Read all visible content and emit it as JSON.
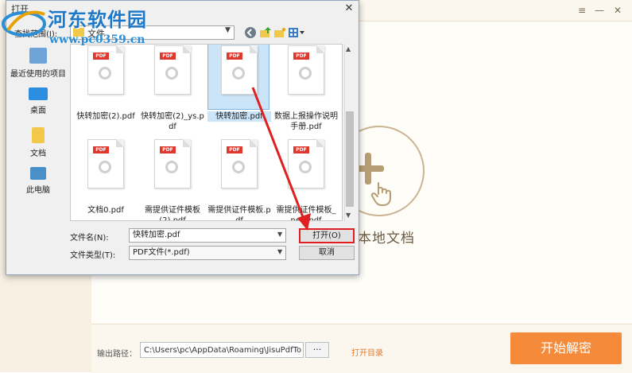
{
  "watermark": {
    "site_name": "河东软件园",
    "url": "www.pc0359.cn"
  },
  "app": {
    "drop_text": "本地文档",
    "output_label": "输出路径：",
    "output_path": "C:\\Users\\pc\\AppData\\Roaming\\JisuPdfTo",
    "browse_label": "···",
    "open_dir_label": "打开目录",
    "start_label": "开始解密"
  },
  "dialog": {
    "title": "打开",
    "close_label": "✕",
    "lookin_label": "查找范围(I):",
    "lookin_value": "文件",
    "places": [
      {
        "label": "最近使用的项目",
        "icon": "recent-icon"
      },
      {
        "label": "桌面",
        "icon": "desktop-icon"
      },
      {
        "label": "文档",
        "icon": "documents-icon"
      },
      {
        "label": "此电脑",
        "icon": "computer-icon"
      }
    ],
    "files": [
      {
        "name": "快转加密(2).pdf",
        "selected": false
      },
      {
        "name": "快转加密(2)_ys.pdf",
        "selected": false
      },
      {
        "name": "快转加密.pdf",
        "selected": true
      },
      {
        "name": "数据上报操作说明手册.pdf",
        "selected": false
      },
      {
        "name": "文档0.pdf",
        "selected": false
      },
      {
        "name": "需提供证件模板(2).pdf",
        "selected": false
      },
      {
        "name": "需提供证件模板.pdf",
        "selected": false
      },
      {
        "name": "需提供证件模板_new.pdf",
        "selected": false
      }
    ],
    "file_badge": "PDF",
    "filename_label": "文件名(N):",
    "filename_value": "快转加密.pdf",
    "filetype_label": "文件类型(T):",
    "filetype_value": "PDF文件(*.pdf)",
    "open_label": "打开(O)",
    "cancel_label": "取消"
  },
  "colors": {
    "accent": "#f58a3a",
    "highlight": "#e02020",
    "selection": "#cce4f7"
  }
}
